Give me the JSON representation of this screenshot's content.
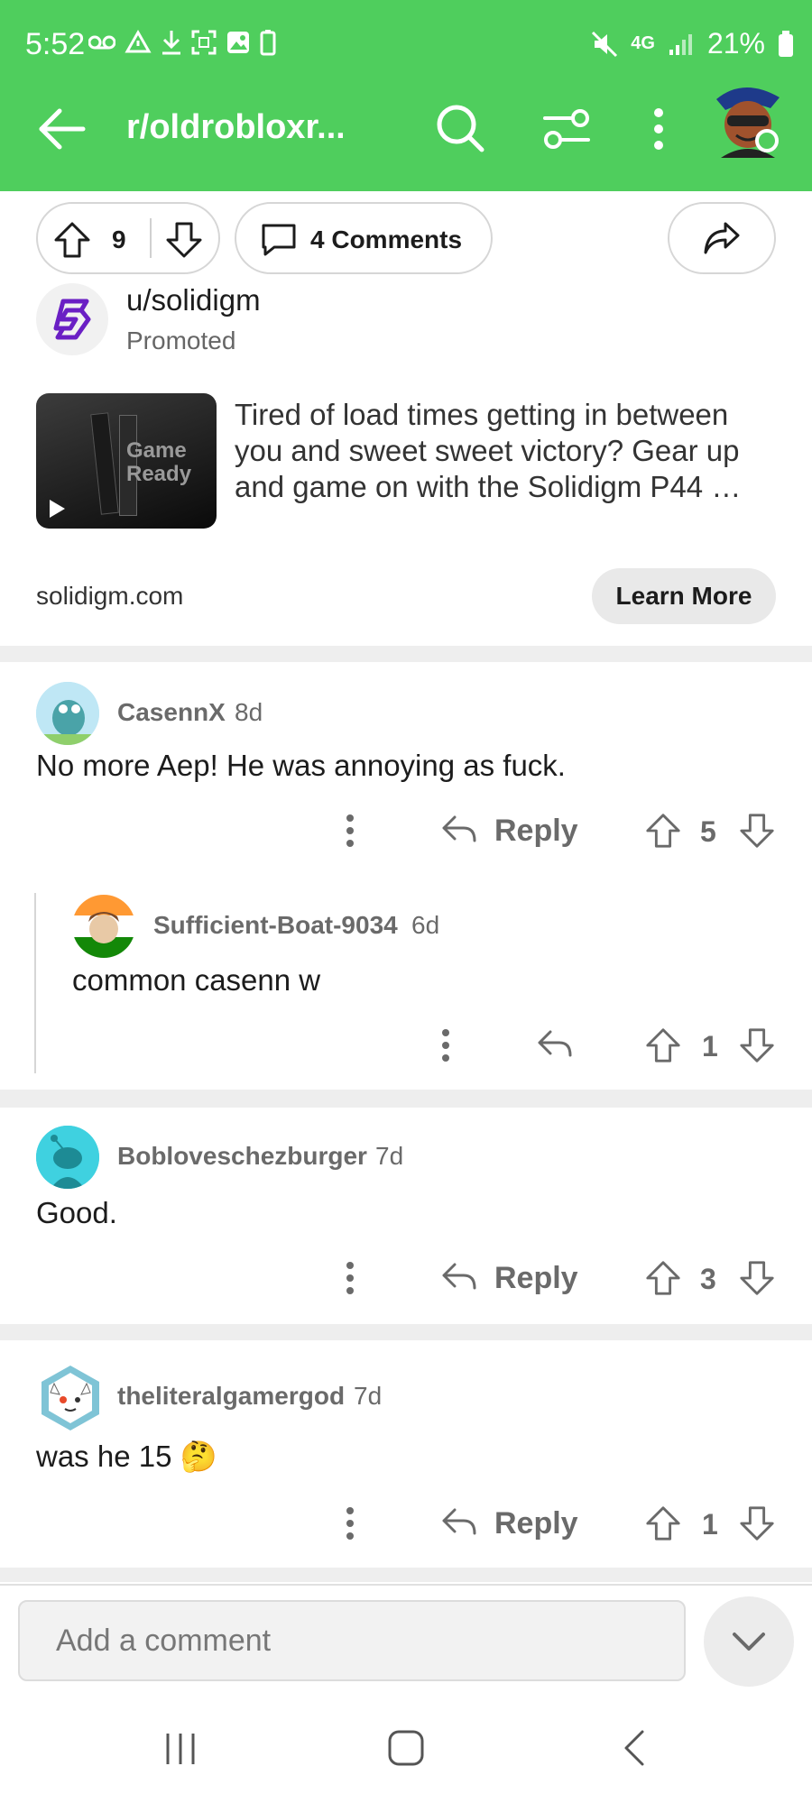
{
  "status_bar": {
    "time": "5:52",
    "battery": "21%",
    "network": "4G"
  },
  "header": {
    "title": "r/oldrobloxr...",
    "icons": [
      "back-arrow-icon",
      "search-icon",
      "filter-icon",
      "more-vert-icon",
      "user-avatar"
    ]
  },
  "post_actions": {
    "votes": "9",
    "comments": "4 Comments"
  },
  "ad": {
    "user": "u/solidigm",
    "promoted": "Promoted",
    "thumb_text_1": "Game",
    "thumb_text_2": "Ready",
    "text": "Tired of load times getting in between you and sweet sweet victory? Gear up and game on with the Solidigm P44 …",
    "domain": "solidigm.com",
    "cta": "Learn More"
  },
  "comments": [
    {
      "author": "CasennX",
      "age": "8d",
      "body": "No more Aep! He was annoying as fuck.",
      "reply": "Reply",
      "score": "5"
    },
    {
      "author": "Sufficient-Boat-9034",
      "age": "6d",
      "body": "common casenn w",
      "score": "1"
    },
    {
      "author": "Bobloveschezburger",
      "age": "7d",
      "body": "Good.",
      "reply": "Reply",
      "score": "3"
    },
    {
      "author": "theliteralgamergod",
      "age": "7d",
      "body": "was he 15 🤔",
      "reply": "Reply",
      "score": "1"
    }
  ],
  "bottom": {
    "input_placeholder": "Add a comment"
  },
  "colors": {
    "header_bg": "#4fce5d",
    "muted": "#6a6a6a"
  }
}
